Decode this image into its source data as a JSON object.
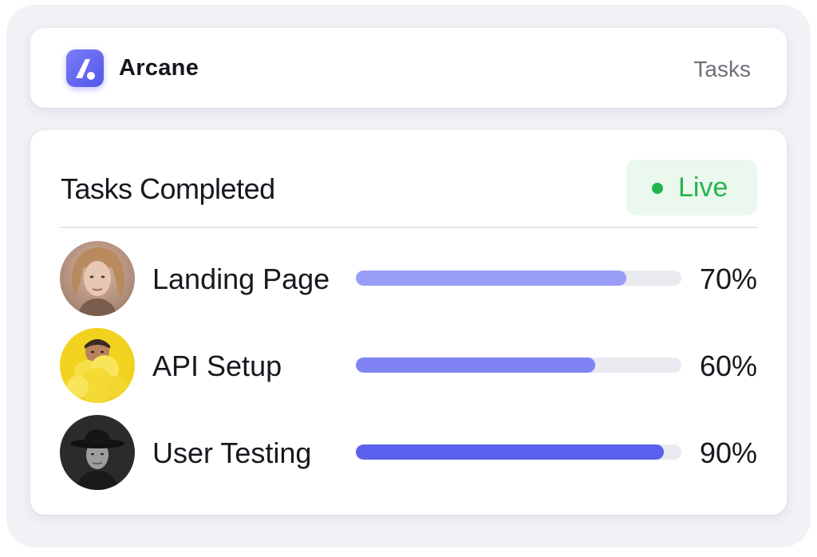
{
  "header": {
    "brand_name": "Arcane",
    "logo_icon": "arcane-logo-icon",
    "nav_tab": "Tasks"
  },
  "widget": {
    "title": "Tasks Completed",
    "status_label": "Live",
    "status_color": "#23b450"
  },
  "tasks": [
    {
      "label": "Landing Page",
      "progress_text": "70%",
      "progress": 0.83,
      "bar_color": "#9a9df8",
      "avatar": "long-haired-man-photo"
    },
    {
      "label": "API Setup",
      "progress_text": "60%",
      "progress": 0.735,
      "bar_color": "#7f83f3",
      "avatar": "man-yellow-smoke-photo"
    },
    {
      "label": "User Testing",
      "progress_text": "90%",
      "progress": 0.945,
      "bar_color": "#5b60ee",
      "avatar": "man-black-hat-photo"
    }
  ],
  "colors": {
    "accent": "#5457ea",
    "live_green": "#23b450",
    "track": "#e9e9f0"
  }
}
